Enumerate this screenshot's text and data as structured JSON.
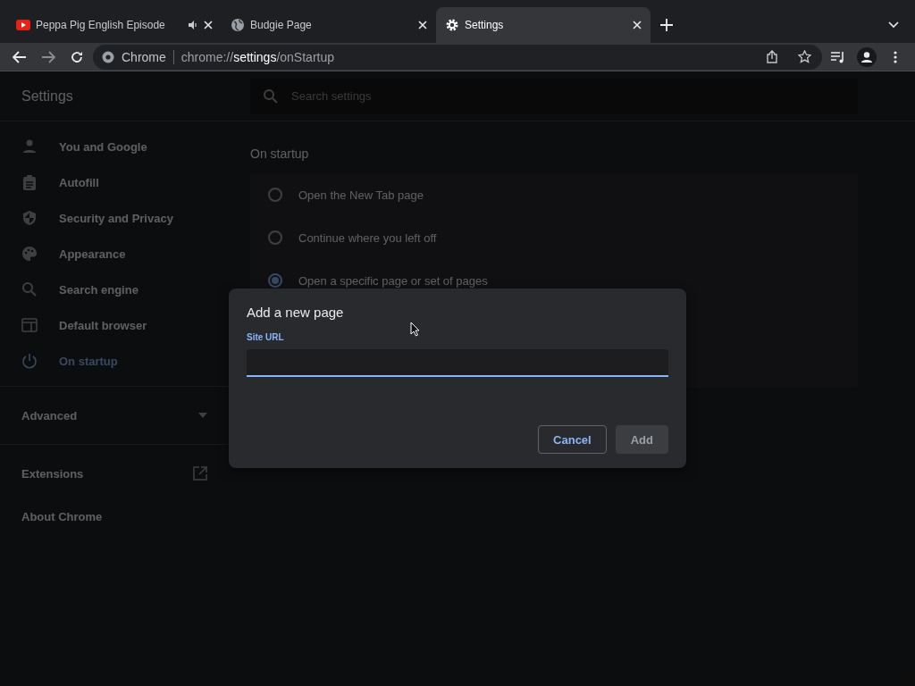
{
  "tabs": [
    {
      "title": "Peppa Pig English Episode",
      "kind": "video",
      "audible": true,
      "selected": false
    },
    {
      "title": "Budgie Page",
      "kind": "globe",
      "audible": false,
      "selected": false
    },
    {
      "title": "Settings",
      "kind": "gear",
      "audible": false,
      "selected": true
    }
  ],
  "address_bar": {
    "origin": "Chrome",
    "url": "chrome://**settings**/onStartup"
  },
  "settings": {
    "title": "Settings",
    "search": {
      "placeholder": "Search settings"
    },
    "nav": [
      {
        "label": "You and Google",
        "kind": "person",
        "selected": false
      },
      {
        "label": "Autofill",
        "kind": "clipboard",
        "selected": false
      },
      {
        "label": "Security and Privacy",
        "kind": "shield",
        "selected": false
      },
      {
        "label": "Appearance",
        "kind": "palette",
        "selected": false
      },
      {
        "label": "Search engine",
        "kind": "search",
        "selected": false
      },
      {
        "label": "Default browser",
        "kind": "browser",
        "selected": false
      },
      {
        "label": "On startup",
        "kind": "power",
        "selected": true
      }
    ],
    "advanced": {
      "label": "Advanced",
      "expanded": false
    },
    "extensions": "Extensions",
    "about": "About Chrome"
  },
  "section": {
    "title": "On startup",
    "options": [
      {
        "label": "Open the New Tab page",
        "selected": false
      },
      {
        "label": "Continue where you left off",
        "selected": false
      },
      {
        "label": "Open a specific page or set of pages",
        "selected": true
      }
    ]
  },
  "dialog": {
    "title": "Add a new page",
    "field_label": "Site URL",
    "buttons": [
      {
        "label": "Cancel",
        "kind": "secondary",
        "disabled": false
      },
      {
        "label": "Add",
        "kind": "primary",
        "disabled": true
      }
    ]
  }
}
